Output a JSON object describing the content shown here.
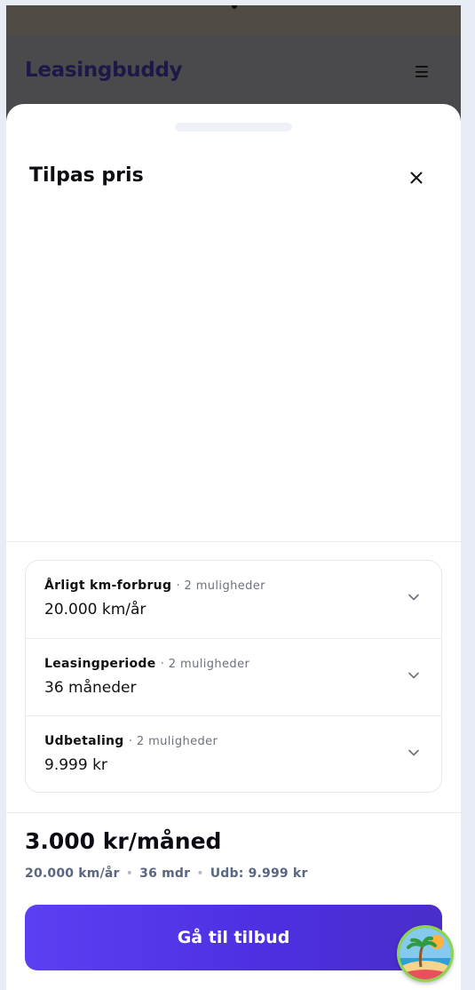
{
  "header": {
    "brand": "Leasingbuddy",
    "menu_icon": "hamburger-icon"
  },
  "sheet": {
    "title": "Tilpas pris",
    "close_icon": "close-icon"
  },
  "options": [
    {
      "label": "Årligt km-forbrug",
      "meta": "· 2 muligheder",
      "value": "20.000 km/år",
      "icon": "chevron-down-icon"
    },
    {
      "label": "Leasingperiode",
      "meta": "· 2 muligheder",
      "value": "36 måneder",
      "icon": "chevron-down-icon"
    },
    {
      "label": "Udbetaling",
      "meta": "· 2 muligheder",
      "value": "9.999 kr",
      "icon": "chevron-down-icon"
    }
  ],
  "summary": {
    "price": "3.000 kr/måned",
    "km": "20.000 km/år",
    "period": "36 mdr",
    "down_payment": "Udb: 9.999 kr",
    "separator": "•"
  },
  "cta": {
    "label": "Gå til tilbud"
  },
  "fab": {
    "icon": "beach-avatar-icon"
  },
  "colors": {
    "accent": "#5b3ff2",
    "brand_text": "#1c1848",
    "backdrop": "#4a4a4c"
  }
}
